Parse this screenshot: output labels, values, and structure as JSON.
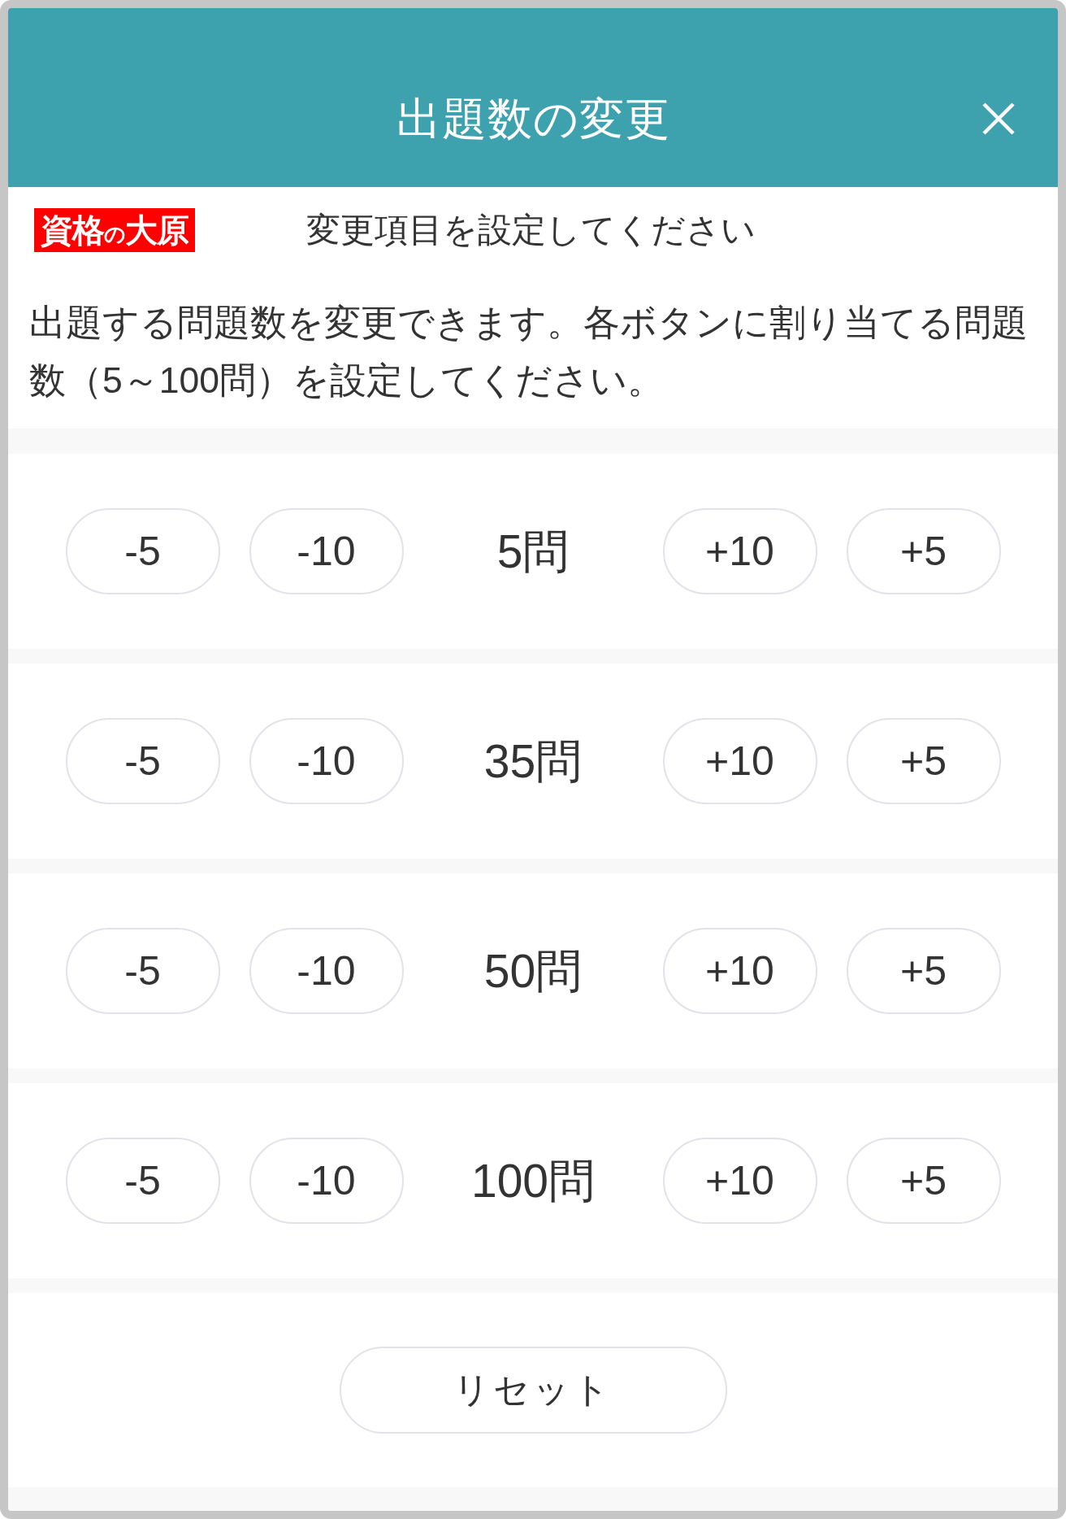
{
  "dialog": {
    "title": "出題数の変更"
  },
  "brand": {
    "logo": "資格$_{の}$大原",
    "subtitle": "変更項目を設定してください"
  },
  "description": "出題する問題数を変更できます。各ボタンに割り当てる問題数（5～100問）を設定してください。",
  "counters": [
    {
      "decrease": [
        "-5",
        "-10"
      ],
      "value": "5問",
      "increase": [
        "+10",
        "+5"
      ]
    },
    {
      "decrease": [
        "-5",
        "-10"
      ],
      "value": "35問",
      "increase": [
        "+10",
        "+5"
      ]
    },
    {
      "decrease": [
        "-5",
        "-10"
      ],
      "value": "50問",
      "increase": [
        "+10",
        "+5"
      ]
    },
    {
      "decrease": [
        "-5",
        "-10"
      ],
      "value": "100問",
      "increase": [
        "+10",
        "+5"
      ]
    }
  ],
  "reset_button": "リセット"
}
